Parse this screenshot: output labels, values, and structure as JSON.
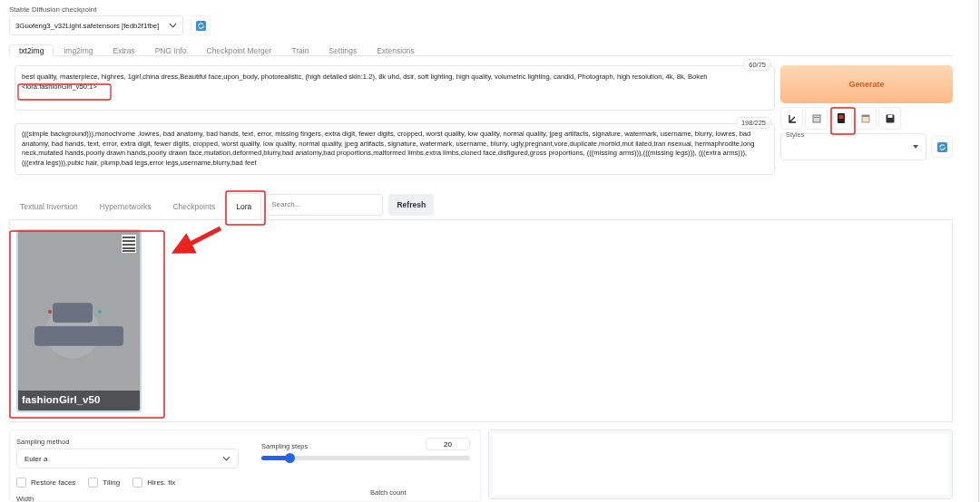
{
  "checkpoint": {
    "label": "Stable Diffusion checkpoint",
    "value": "3Guofeng3_v32Light.safetensors [fedb2f1fbe]"
  },
  "tabs": [
    {
      "label": "txt2img",
      "selected": true
    },
    {
      "label": "img2img",
      "selected": false
    },
    {
      "label": "Extras",
      "selected": false
    },
    {
      "label": "PNG Info",
      "selected": false
    },
    {
      "label": "Checkpoint Merger",
      "selected": false
    },
    {
      "label": "Train",
      "selected": false
    },
    {
      "label": "Settings",
      "selected": false
    },
    {
      "label": "Extensions",
      "selected": false
    }
  ],
  "prompt": {
    "counter": "60/75",
    "value": "best quality, masterpiece, highres, 1girl,china dress,Beautiful face,upon_body, photorealistic, (high detailed skin:1.2), 8k uhd, dslr, soft lighting, high quality, volumetric lighting, candid, Photograph, high resolution, 4k, 8k, Bokeh",
    "lora_tag": "<lora:fashionGirl_v50:1>"
  },
  "negative_prompt": {
    "counter": "198/225",
    "value": "(((simple background))),monochrome ,lowres, bad anatomy, bad hands, text, error, missing fingers, extra digit, fewer digits, cropped, worst quality, low quality, normal quality, jpeg artifacts, signature, watermark, username, blurry, lowres, bad anatomy, bad hands, text, error, extra digit, fewer digits, cropped, worst quality, low quality, normal quality, jpeg artifacts, signature, watermark, username, blurry, ugly,pregnant,vore,duplicate,morbid,mut ilated,tran nsexual, hermaphrodite,long neck,mutated hands,poorly drawn hands,poorly drawn face,mutation,deformed,blurry,bad anatomy,bad proportions,malformed limbs,extra limbs,cloned face,disfigured,gross proportions, (((missing arms))),(((missing legs))), (((extra arms))),(((extra legs))),pubic hair, plump,bad legs,error legs,username,blurry,bad feet"
  },
  "generate_button": "Generate",
  "tool_buttons": [
    {
      "kind": "arrow"
    },
    {
      "kind": "trash"
    },
    {
      "kind": "networks"
    },
    {
      "kind": "clipboard"
    },
    {
      "kind": "save"
    }
  ],
  "styles": {
    "label": "Styles"
  },
  "network_tabs": [
    {
      "label": "Textual Inversion",
      "selected": false
    },
    {
      "label": "Hypernetworks",
      "selected": false
    },
    {
      "label": "Checkpoints",
      "selected": false
    },
    {
      "label": "Lora",
      "selected": true
    }
  ],
  "network_search": {
    "placeholder": "Search..."
  },
  "refresh_button": "Refresh",
  "cards": [
    {
      "name": "fashionGirl_v50",
      "kind": "picture"
    }
  ],
  "sampling_method": {
    "label": "Sampling method",
    "value": "Euler a"
  },
  "sampling_steps": {
    "label": "Sampling steps",
    "value": "20",
    "level": 0.14
  },
  "checkboxes": [
    {
      "label": "Restore faces",
      "checked": false
    },
    {
      "label": "Tiling",
      "checked": false
    },
    {
      "label": "Hires. fix",
      "checked": false
    }
  ],
  "width": {
    "label": "Width"
  },
  "batch_count": {
    "label": "Batch count"
  }
}
